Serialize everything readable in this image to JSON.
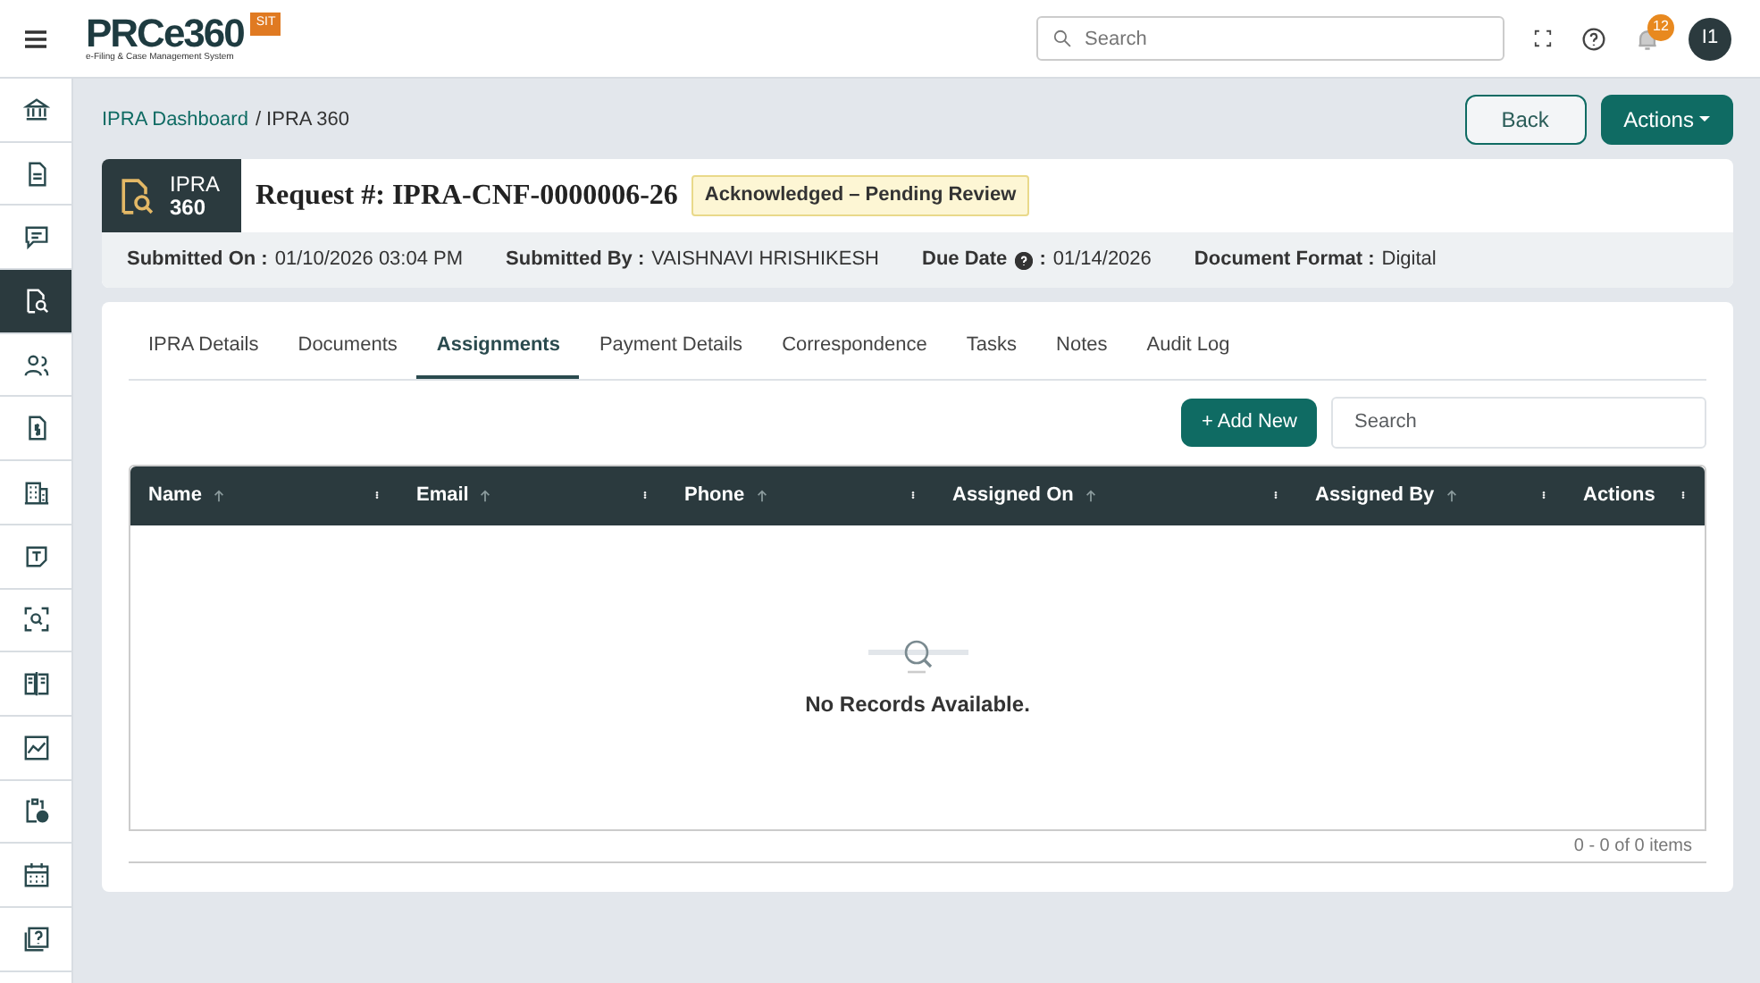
{
  "header": {
    "logo": "PRCe360",
    "logo_tagline": "e-Filing & Case Management System",
    "env_badge": "SIT",
    "search": {
      "placeholder": "Search"
    },
    "notifications": "12",
    "avatar": "I1"
  },
  "sidebar": {
    "items": [
      {
        "selected": false
      },
      {
        "selected": false
      },
      {
        "selected": false
      },
      {
        "selected": true
      },
      {
        "selected": false
      },
      {
        "selected": false
      },
      {
        "selected": false
      },
      {
        "selected": false
      },
      {
        "selected": false
      },
      {
        "selected": false
      },
      {
        "selected": false
      },
      {
        "selected": false
      },
      {
        "selected": false
      },
      {
        "selected": false
      }
    ]
  },
  "breadcrumb": [
    {
      "label": "IPRA Dashboard",
      "link": true
    },
    {
      "label": "/ IPRA 360",
      "link": false
    }
  ],
  "page_buttons": [
    {
      "label": "Back",
      "kind": "outline"
    },
    {
      "label": "Actions",
      "kind": "dropdown"
    }
  ],
  "request": {
    "badge_line1": "IPRA",
    "badge_line2": "360",
    "title": "Request #: IPRA-CNF-0000006-26",
    "status": "Acknowledged – Pending Review",
    "meta": [
      {
        "label": "Submitted On :",
        "value": "01/10/2026 03:04 PM",
        "info": false
      },
      {
        "label": "Submitted By :",
        "value": "VAISHNAVI HRISHIKESH",
        "info": false
      },
      {
        "label": "Due Date",
        "suffix": ":",
        "value": "01/14/2026",
        "info": true
      },
      {
        "label": "Document Format :",
        "value": "Digital",
        "info": false
      }
    ]
  },
  "tabs": [
    {
      "label": "IPRA Details",
      "selected": false
    },
    {
      "label": "Documents",
      "selected": false
    },
    {
      "label": "Assignments",
      "selected": true
    },
    {
      "label": "Payment Details",
      "selected": false
    },
    {
      "label": "Correspondence",
      "selected": false
    },
    {
      "label": "Tasks",
      "selected": false
    },
    {
      "label": "Notes",
      "selected": false
    },
    {
      "label": "Audit Log",
      "selected": false
    }
  ],
  "toolbar": {
    "add_button": "+ Add New",
    "search": {
      "placeholder": "Search"
    }
  },
  "table": {
    "columns": [
      {
        "label": "Name",
        "sortable": true
      },
      {
        "label": "Email",
        "sortable": true
      },
      {
        "label": "Phone",
        "sortable": true
      },
      {
        "label": "Assigned On",
        "sortable": true
      },
      {
        "label": "Assigned By",
        "sortable": true
      },
      {
        "label": "Actions",
        "sortable": false
      }
    ],
    "empty_message": "No Records Available.",
    "pager": "0 - 0 of 0 items"
  }
}
